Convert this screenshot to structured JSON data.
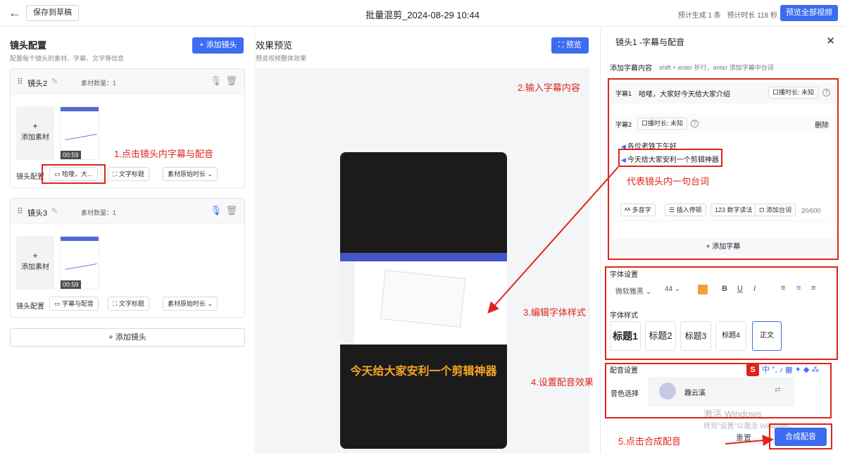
{
  "topbar": {
    "save_draft": "保存到草稿",
    "title": "批量混剪_2024-08-29 10:44",
    "est_count": "预计生成 1 条",
    "est_duration": "预计时长 118 秒",
    "preview_all": "预览全部视频"
  },
  "left": {
    "title": "镜头配置",
    "subtitle": "配置每个镜头的素材、字幕、文字等信息",
    "add_shot_button": "+ 添加镜头",
    "shots": [
      {
        "name": "镜头2",
        "material_count": "素材数量：1",
        "add_material": "添加素材",
        "duration": "00:59",
        "config_label": "镜头配置",
        "subtitle_chip": "哈喽，大...",
        "text_title_chip": "文字标题",
        "duration_chip": "素材原始时长"
      },
      {
        "name": "镜头3",
        "material_count": "素材数量：1",
        "add_material": "添加素材",
        "duration": "00:59",
        "config_label": "镜头配置",
        "subtitle_chip": "字幕与配音",
        "text_title_chip": "文字标题",
        "duration_chip": "素材原始时长"
      }
    ],
    "add_shot_bottom": "+ 添加镜头"
  },
  "middle": {
    "title": "效果预览",
    "subtitle": "预览视频整体效果",
    "preview_button": "预览",
    "video_subtitle": "今天给大家安利一个剪辑神器"
  },
  "right": {
    "title": "镜头1 -字幕与配音",
    "add_subtitle_label": "添加字幕内容",
    "add_subtitle_hint": "shift + enter 折行，enter 添加字幕中台词",
    "subtitle1_label": "字幕1",
    "subtitle1_text": "哈喽，大家好今天给大家介绍",
    "subtitle1_duration": "口播时长: 未知",
    "subtitle2_label": "字幕2",
    "subtitle2_duration": "口播时长: 未知",
    "delete": "删除",
    "lines": [
      "各位老铁下午好",
      "今天给大家安利一个剪辑神器"
    ],
    "tools": [
      "多音字",
      "插入停顿",
      "数字读法",
      "添加台词"
    ],
    "char_count": "20/600",
    "add_subtitle_button": "+ 添加字幕",
    "font_section": "字体设置",
    "font_name": "微软雅黑",
    "font_size": "44",
    "style_section": "字体样式",
    "styles": [
      "标题1",
      "标题2",
      "标题3",
      "标题4",
      "正文"
    ],
    "voice_section": "配音设置",
    "voice_label": "音色选择",
    "voice_name": "趣云溪",
    "reset": "重置",
    "synthesize": "合成配音"
  },
  "annotations": {
    "a1": "1.点击镜头内字幕与配音",
    "a2": "2.输入字幕内容",
    "a_line": "代表镜头内一句台词",
    "a3": "3.编辑字体样式",
    "a4": "4.设置配音效果",
    "a5": "5.点击合成配音"
  },
  "watermark": {
    "line1": "激活 Windows",
    "line2": "转到\"设置\"以激活 Windows。"
  },
  "ime": {
    "logo": "S",
    "text": "中 °, ♪ ▦ ✦ ◆ ⁂"
  },
  "colors": {
    "accent": "#3c6cf0",
    "annotation": "#e0241b",
    "subtitle": "#f5a623"
  }
}
